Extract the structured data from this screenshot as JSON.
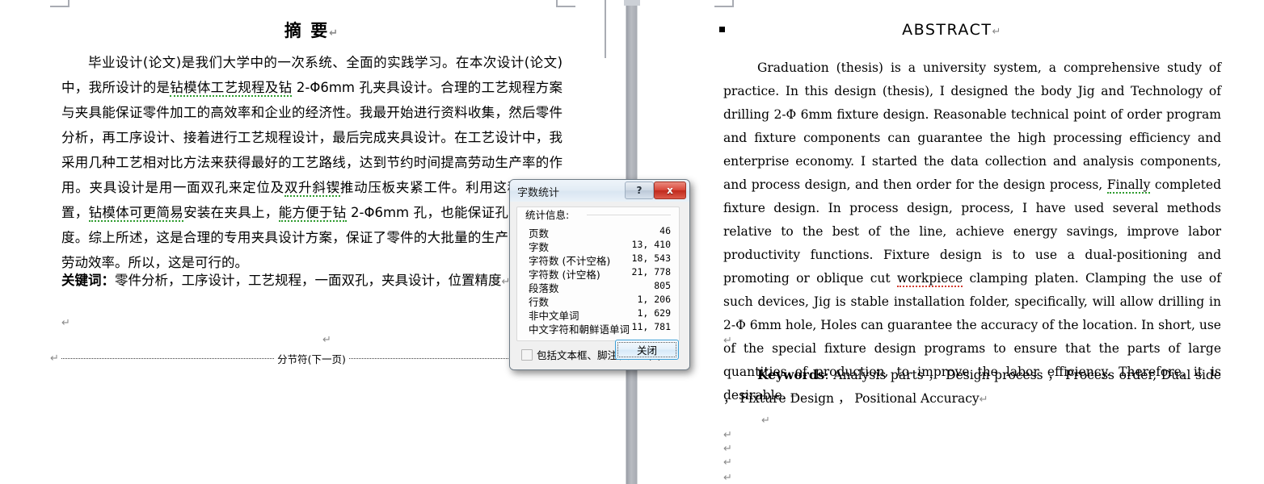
{
  "window": {
    "app": "word-document-view"
  },
  "page_left": {
    "title": "摘 要",
    "paragraphs": [
      "毕业设计(论文)是我们大学中的一次系统、全面的实践学习。在本次设计(论文)中，我所设计的是钻模体工艺规程及钻 2-Φ6mm 孔夹具设计。合理的工艺规程方案与夹具能保证零件加工的高效率和企业的经济性。我最开始进行资料收集，然后零件分析，再工序设计、接着进行工艺规程设计，最后完成夹具设计。在工艺设计中，我采用几种工艺相对比方法来获得最好的工艺路线，达到节约时间提高劳动生产率的作用。夹具设计是用一面双孔来定位及双升斜锲推动压板夹紧工件。利用这种夹紧装置，钻模体可更简易安装在夹具上，能方便于钻 2-Φ6mm 孔，也能保证孔的位置精度。综上所述，这是合理的专用夹具设计方案，保证了零件的大批量的生产，提高了劳动效率。所以，这是可行的。"
    ],
    "keywords_label": "关键词：",
    "keywords_value": "零件分析，工序设计，工艺规程，一面双孔，夹具设计，位置精度",
    "section_break_label": "分节符(下一页)"
  },
  "page_right": {
    "title": "ABSTRACT",
    "paragraph": "Graduation (thesis) is a university system, a comprehensive study of practice. In this design (thesis), I designed the body Jig and Technology of drilling 2-Φ 6mm fixture design. Reasonable technical point of order program and fixture components can guarantee the high processing efficiency and enterprise economy. I started the data collection and analysis components, and process design, and then order for the design process, Finally completed fixture design. In process design, process, I have used several methods relative to the best of the line, achieve energy savings, improve labor productivity functions. Fixture design is to use a dual-positioning and promoting or oblique cut workpiece clamping platen. Clamping the use of such devices, Jig is stable installation folder, specifically, will allow drilling in 2-Φ 6mm hole, Holes can guarantee the accuracy of the location. In short, use of the special fixture design programs to ensure that the parts of large quantities of production, to improve the labor efficiency. Therefore, it is desirable.",
    "keywords_label": "Keywords",
    "keywords_value": ": Analysis parts ， Design process ， Process order, Dual side ， Fixture Design ， Positional Accuracy"
  },
  "dialog": {
    "title": "字数统计",
    "help_glyph": "?",
    "close_glyph": "x",
    "group_title": "统计信息:",
    "stats": [
      {
        "label": "页数",
        "value": "46"
      },
      {
        "label": "字数",
        "value": "13, 410"
      },
      {
        "label": "字符数 (不计空格)",
        "value": "18, 543"
      },
      {
        "label": "字符数 (计空格)",
        "value": "21, 778"
      },
      {
        "label": "段落数",
        "value": "805"
      },
      {
        "label": "行数",
        "value": "1, 206"
      },
      {
        "label": "非中文单词",
        "value": "1, 629"
      },
      {
        "label": "中文字符和朝鲜语单词",
        "value": "11, 781"
      }
    ],
    "checkbox_label": "包括文本框、脚注和尾注(F)",
    "checkbox_checked": false,
    "close_button": "关闭"
  },
  "marks": {
    "pilcrow": "↵"
  },
  "colors": {
    "canvas": "#ccd0d6",
    "page": "#ffffff",
    "margin_marker": "#a9acb3",
    "dialog_face": "#f0f0f0",
    "close_red": "#c0291c",
    "focus_blue": "#3c9fd6",
    "spell_green": "#2e9b2e",
    "spell_red": "#d23b2e"
  }
}
